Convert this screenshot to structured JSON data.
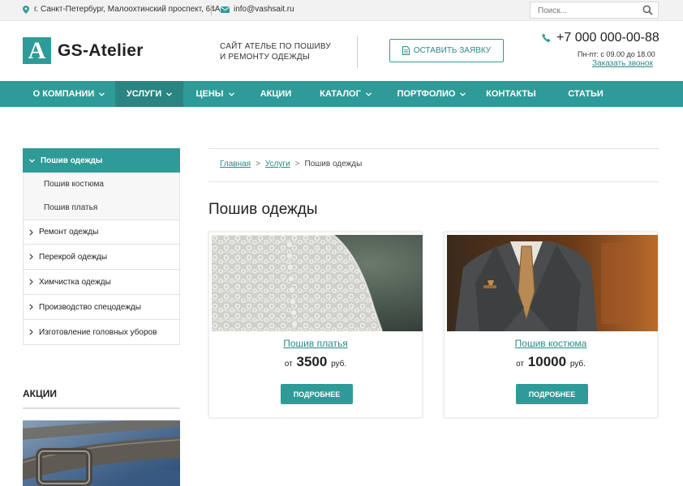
{
  "topbar": {
    "address": "г. Санкт-Петербург, Малоохтинский проспект, 64А",
    "email": "info@vashsait.ru",
    "search_placeholder": "Поиск..."
  },
  "header": {
    "logo_letter": "A",
    "logo_text": "GS-Atelier",
    "slogan_line1": "САЙТ АТЕЛЬЕ ПО ПОШИВУ",
    "slogan_line2": "И РЕМОНТУ ОДЕЖДЫ",
    "request_button": "ОСТАВИТЬ ЗАЯВКУ",
    "phone": "+7 000 000-00-88",
    "hours": "Пн-пт: с 09.00 до 18.00",
    "callback_link": "Заказать звонок"
  },
  "nav": {
    "items": [
      {
        "label": "О КОМПАНИИ",
        "has_dropdown": true
      },
      {
        "label": "УСЛУГИ",
        "has_dropdown": true,
        "active": true
      },
      {
        "label": "ЦЕНЫ",
        "has_dropdown": true
      },
      {
        "label": "АКЦИИ",
        "has_dropdown": false
      },
      {
        "label": "КАТАЛОГ",
        "has_dropdown": true
      },
      {
        "label": "ПОРТФОЛИО",
        "has_dropdown": true
      },
      {
        "label": "КОНТАКТЫ",
        "has_dropdown": false
      },
      {
        "label": "СТАТЬИ",
        "has_dropdown": false
      }
    ]
  },
  "sidebar": {
    "active": "Пошив одежды",
    "subitems": [
      "Пошив костюма",
      "Пошив платья"
    ],
    "items": [
      "Ремонт одежды",
      "Перекрой одежды",
      "Химчистка одежды",
      "Производство спецодежды",
      "Изготовление головных уборов"
    ],
    "promo_title": "АКЦИИ"
  },
  "breadcrumb": {
    "home": "Главная",
    "services": "Услуги",
    "current": "Пошив одежды",
    "separator": ">"
  },
  "page": {
    "title": "Пошив одежды"
  },
  "cards": [
    {
      "title": "Пошив платья",
      "price_prefix": "от",
      "price": "3500",
      "currency": "руб.",
      "button": "ПОДРОБНЕЕ"
    },
    {
      "title": "Пошив костюма",
      "price_prefix": "от",
      "price": "10000",
      "currency": "руб.",
      "button": "ПОДРОБНЕЕ"
    }
  ],
  "icons": {
    "address": "map-pin-icon",
    "email": "envelope-icon",
    "search": "search-icon",
    "request": "document-icon",
    "phone": "phone-icon",
    "dropdown": "chevron-down-icon",
    "list": "chevron-right-icon"
  },
  "colors": {
    "accent": "#2f9b98",
    "accent_dark": "#2a8481",
    "link": "#2a8a87",
    "topbar_bg": "#f2f2f2"
  }
}
